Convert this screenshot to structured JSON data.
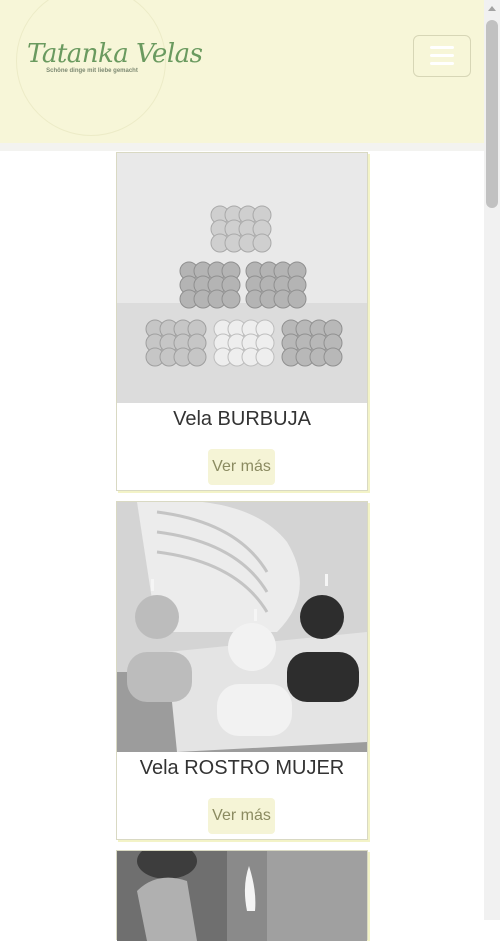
{
  "brand": {
    "name": "Tatanka Velas",
    "tagline": "Schöne dinge mit liebe gemacht"
  },
  "menu": {
    "icon": "hamburger-menu-icon"
  },
  "products": [
    {
      "title": "Vela BURBUJA",
      "button": "Ver más",
      "image": "bubble-candles-photo"
    },
    {
      "title": "Vela ROSTRO MUJER",
      "button": "Ver más",
      "image": "woman-face-candles-photo"
    },
    {
      "title": "",
      "button": "",
      "image": "lit-candle-photo"
    }
  ],
  "colors": {
    "header_bg": "#f7f6d8",
    "logo_text": "#6a9a5f",
    "button_bg": "#f5f4d6",
    "button_text": "#8b8b61"
  }
}
